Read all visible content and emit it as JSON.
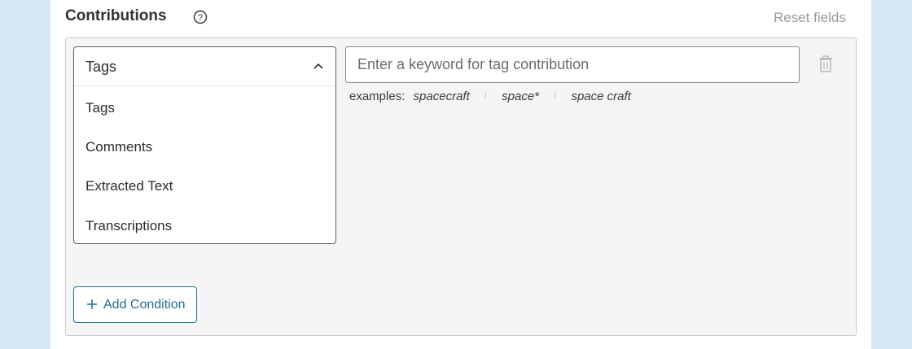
{
  "section": {
    "title": "Contributions",
    "reset_label": "Reset fields"
  },
  "condition": {
    "field_select": {
      "selected": "Tags",
      "options": [
        "Tags",
        "Comments",
        "Extracted Text",
        "Transcriptions"
      ]
    },
    "keyword_input": {
      "value": "",
      "placeholder": "Enter a keyword for tag contribution"
    },
    "examples": {
      "label": "examples:",
      "items": [
        "spacecraft",
        "space*",
        "space craft"
      ],
      "separator": "I"
    }
  },
  "actions": {
    "add_condition_label": "Add Condition"
  },
  "colors": {
    "page_background": "#d6e6f3",
    "accent": "#1f6e8c",
    "muted_text": "#9a9a9a",
    "group_background": "#f5f5f5"
  },
  "icons": [
    "help-icon",
    "chevron-up-icon",
    "trash-icon",
    "plus-icon"
  ]
}
